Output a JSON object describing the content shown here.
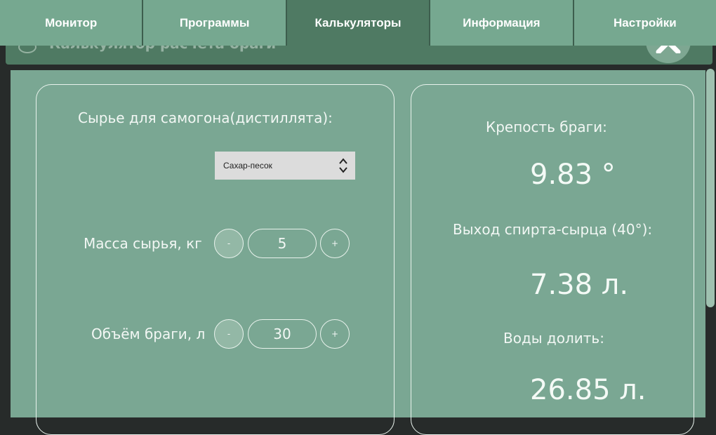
{
  "tabs": [
    {
      "label": "Монитор"
    },
    {
      "label": "Программы"
    },
    {
      "label": "Калькуляторы"
    },
    {
      "label": "Информация"
    },
    {
      "label": "Настройки"
    }
  ],
  "active_tab": 2,
  "window": {
    "title": "Калькулятор расчёта браги"
  },
  "left": {
    "raw_label": "Сырье для самогона(дистиллята):",
    "raw_select_value": "Сахар-песок",
    "mass": {
      "label": "Масса сырья, кг",
      "value": "5",
      "minus": "-",
      "plus": "+"
    },
    "volume": {
      "label": "Объём браги, л",
      "value": "30",
      "minus": "-",
      "plus": "+"
    }
  },
  "right": {
    "strength_label": "Крепость браги:",
    "strength_value": "9.83 °",
    "yield_label": "Выход спирта-сырца (40°):",
    "yield_value": "7.38 л.",
    "water_label": "Воды долить:",
    "water_value": "26.85 л."
  },
  "colors": {
    "tab_bg": "#76a890",
    "tab_active": "#4f7a63",
    "panel_bg": "#7aa793",
    "page_bg": "#272b2a"
  }
}
